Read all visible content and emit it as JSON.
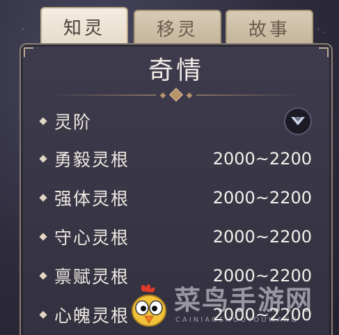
{
  "tabs": [
    {
      "label": "知灵",
      "active": true
    },
    {
      "label": "移灵",
      "active": false
    },
    {
      "label": "故事",
      "active": false
    }
  ],
  "panel": {
    "title": "奇情",
    "rows": [
      {
        "label": "灵阶",
        "value": ""
      },
      {
        "label": "勇毅灵根",
        "value": "2000~2200"
      },
      {
        "label": "强体灵根",
        "value": "2000~2200"
      },
      {
        "label": "守心灵根",
        "value": "2000~2200"
      },
      {
        "label": "禀赋灵根",
        "value": "2000~2200"
      },
      {
        "label": "心魄灵根",
        "value": "2000~2200"
      }
    ],
    "expand_icon": "chevron-down-icon"
  },
  "watermark": {
    "text": "菜鸟手游网",
    "subtext": "CAINIAOSHOUYOUWANG",
    "mascot_icon": "bird-mascot-icon"
  },
  "colors": {
    "panel_bg": "#3a3747",
    "tab_active": "#f0e7d8",
    "tab_inactive": "#cdbfa8",
    "accent_gold": "#c9a57a",
    "text_light": "#eee9e2"
  }
}
